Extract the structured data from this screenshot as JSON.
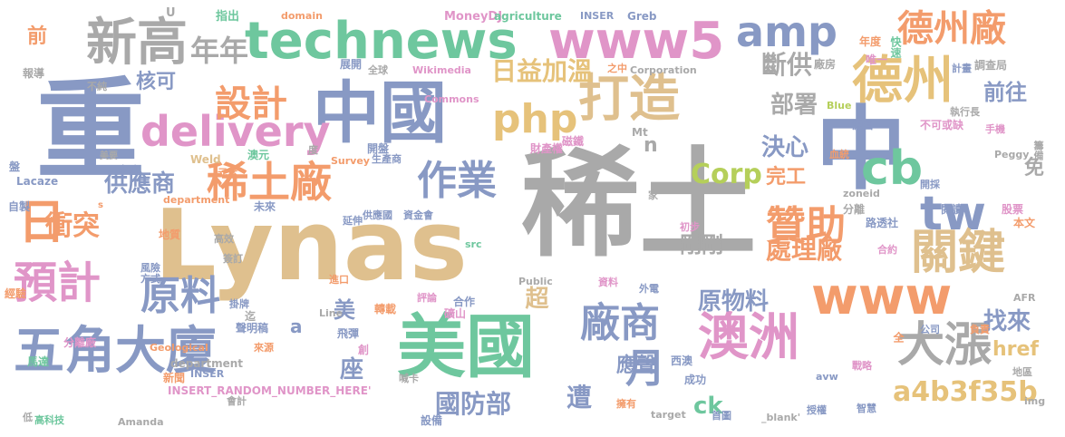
{
  "palette": {
    "grey": "#a9a9a9",
    "tan": "#dfc08e",
    "blue": "#8899c4",
    "green": "#6ec79e",
    "orange": "#f39c6c",
    "pink": "#e095c8",
    "olive": "#b5cf5a",
    "sand": "#e6c27a",
    "lightgrey": "#c2c2c2"
  },
  "words": [
    {
      "text": "稀土",
      "color": "grey"
    },
    {
      "text": "Lynas",
      "color": "tan"
    },
    {
      "text": "中國",
      "color": "blue"
    },
    {
      "text": "重",
      "color": "blue"
    },
    {
      "text": "美國",
      "color": "green"
    },
    {
      "text": "中",
      "color": "blue"
    },
    {
      "text": "technews",
      "color": "green"
    },
    {
      "text": "www5",
      "color": "pink"
    },
    {
      "text": "新高",
      "color": "grey"
    },
    {
      "text": "打造",
      "color": "tan"
    },
    {
      "text": "德州",
      "color": "sand"
    },
    {
      "text": "德州廠",
      "color": "orange"
    },
    {
      "text": "五角大廈",
      "color": "blue"
    },
    {
      "text": "澳洲",
      "color": "pink"
    },
    {
      "text": "稀土廠",
      "color": "orange"
    },
    {
      "text": "delivery",
      "color": "pink"
    },
    {
      "text": "php",
      "color": "sand"
    },
    {
      "text": "amp",
      "color": "blue"
    },
    {
      "text": "cb",
      "color": "green"
    },
    {
      "text": "tw",
      "color": "blue"
    },
    {
      "text": "www",
      "color": "orange"
    },
    {
      "text": "關鍵",
      "color": "tan"
    },
    {
      "text": "大漲",
      "color": "grey"
    },
    {
      "text": "預計",
      "color": "pink"
    },
    {
      "text": "日",
      "color": "orange"
    },
    {
      "text": "原料",
      "color": "blue"
    },
    {
      "text": "贊助",
      "color": "orange"
    },
    {
      "text": "設計",
      "color": "orange"
    },
    {
      "text": "作業",
      "color": "blue"
    },
    {
      "text": "廠商",
      "color": "blue"
    },
    {
      "text": "月",
      "color": "blue"
    },
    {
      "text": "年年",
      "color": "grey"
    },
    {
      "text": "日益加溫",
      "color": "sand"
    },
    {
      "text": "a4b3f35b",
      "color": "sand"
    },
    {
      "text": "衝突",
      "color": "orange"
    },
    {
      "text": "供應商",
      "color": "blue"
    },
    {
      "text": "Corp",
      "color": "olive"
    },
    {
      "text": "決心",
      "color": "blue"
    },
    {
      "text": "處理廠",
      "color": "orange"
    },
    {
      "text": "原物料",
      "color": "blue"
    },
    {
      "text": "國防部",
      "color": "blue"
    },
    {
      "text": "找來",
      "color": "blue"
    },
    {
      "text": "前往",
      "color": "blue"
    },
    {
      "text": "部署",
      "color": "grey"
    },
    {
      "text": "斷供",
      "color": "grey"
    },
    {
      "text": "核可",
      "color": "blue"
    },
    {
      "text": "前",
      "color": "orange"
    },
    {
      "text": "完工",
      "color": "orange"
    },
    {
      "text": "剛剛",
      "color": "grey"
    },
    {
      "text": "應聲",
      "color": "blue"
    },
    {
      "text": "遭",
      "color": "blue"
    },
    {
      "text": "ck",
      "color": "green"
    },
    {
      "text": "href",
      "color": "sand"
    },
    {
      "text": "美",
      "color": "blue"
    },
    {
      "text": "座",
      "color": "blue"
    },
    {
      "text": "超",
      "color": "tan"
    },
    {
      "text": "免",
      "color": "grey"
    },
    {
      "text": "n",
      "color": "grey"
    },
    {
      "text": "a",
      "color": "blue"
    },
    {
      "text": "指出",
      "color": "green"
    },
    {
      "text": "domain",
      "color": "orange"
    },
    {
      "text": "MoneyDJ",
      "color": "pink"
    },
    {
      "text": "agriculture",
      "color": "green"
    },
    {
      "text": "INSER",
      "color": "blue"
    },
    {
      "text": "Greb",
      "color": "blue"
    },
    {
      "text": "U",
      "color": "grey"
    },
    {
      "text": "年度",
      "color": "orange"
    },
    {
      "text": "唯一",
      "color": "pink"
    },
    {
      "text": "快速",
      "color": "green"
    },
    {
      "text": "廠房",
      "color": "grey"
    },
    {
      "text": "調查局",
      "color": "grey"
    },
    {
      "text": "報導",
      "color": "grey"
    },
    {
      "text": "展開",
      "color": "blue"
    },
    {
      "text": "全球",
      "color": "grey"
    },
    {
      "text": "Wikimedia",
      "color": "pink"
    },
    {
      "text": "之中",
      "color": "orange"
    },
    {
      "text": "Corporation",
      "color": "grey"
    },
    {
      "text": "計畫",
      "color": "blue"
    },
    {
      "text": "不純",
      "color": "grey"
    },
    {
      "text": "Commons",
      "color": "pink"
    },
    {
      "text": "Blue",
      "color": "olive"
    },
    {
      "text": "執行長",
      "color": "grey"
    },
    {
      "text": "Mt",
      "color": "grey"
    },
    {
      "text": "源自",
      "color": "blue"
    },
    {
      "text": "不可或缺",
      "color": "pink"
    },
    {
      "text": "手機",
      "color": "pink"
    },
    {
      "text": "盤",
      "color": "blue"
    },
    {
      "text": "美要",
      "color": "grey"
    },
    {
      "text": "金融",
      "color": "blue"
    },
    {
      "text": "澳元",
      "color": "green"
    },
    {
      "text": "度",
      "color": "grey"
    },
    {
      "text": "開盤",
      "color": "blue"
    },
    {
      "text": "財產權",
      "color": "pink"
    },
    {
      "text": "磁鐵",
      "color": "pink"
    },
    {
      "text": "血統",
      "color": "orange"
    },
    {
      "text": "Peggy",
      "color": "grey"
    },
    {
      "text": "籌備",
      "color": "grey"
    },
    {
      "text": "Weld",
      "color": "tan"
    },
    {
      "text": "元素",
      "color": "orange"
    },
    {
      "text": "Survey",
      "color": "orange"
    },
    {
      "text": "生產商",
      "color": "blue"
    },
    {
      "text": "Lacaze",
      "color": "blue"
    },
    {
      "text": "department",
      "color": "orange"
    },
    {
      "text": "家",
      "color": "grey"
    },
    {
      "text": "zoneid",
      "color": "grey"
    },
    {
      "text": "開採",
      "color": "blue"
    },
    {
      "text": "自製",
      "color": "blue"
    },
    {
      "text": "s",
      "color": "orange"
    },
    {
      "text": "未來",
      "color": "blue"
    },
    {
      "text": "延伸",
      "color": "blue"
    },
    {
      "text": "供應國",
      "color": "blue"
    },
    {
      "text": "資金會",
      "color": "blue"
    },
    {
      "text": "分離",
      "color": "grey"
    },
    {
      "text": "路透社",
      "color": "blue"
    },
    {
      "text": "閱讀",
      "color": "blue"
    },
    {
      "text": "股票",
      "color": "pink"
    },
    {
      "text": "本文",
      "color": "orange"
    },
    {
      "text": "地質",
      "color": "orange"
    },
    {
      "text": "高效",
      "color": "grey"
    },
    {
      "text": "src",
      "color": "green"
    },
    {
      "text": "初步",
      "color": "pink"
    },
    {
      "text": "合約",
      "color": "pink"
    },
    {
      "text": "簽訂",
      "color": "grey"
    },
    {
      "text": "風險",
      "color": "blue"
    },
    {
      "text": "方式",
      "color": "blue"
    },
    {
      "text": "進口",
      "color": "orange"
    },
    {
      "text": "Public",
      "color": "grey"
    },
    {
      "text": "資料",
      "color": "pink"
    },
    {
      "text": "外電",
      "color": "blue"
    },
    {
      "text": "AFR",
      "color": "grey"
    },
    {
      "text": "經驗",
      "color": "orange"
    },
    {
      "text": "掛牌",
      "color": "blue"
    },
    {
      "text": "轉載",
      "color": "orange"
    },
    {
      "text": "評論",
      "color": "pink"
    },
    {
      "text": "合作",
      "color": "blue"
    },
    {
      "text": "礦山",
      "color": "pink"
    },
    {
      "text": "迄",
      "color": "grey"
    },
    {
      "text": "聲明稿",
      "color": "blue"
    },
    {
      "text": "Line",
      "color": "grey"
    },
    {
      "text": "公司",
      "color": "blue"
    },
    {
      "text": "負責",
      "color": "orange"
    },
    {
      "text": "分離廠",
      "color": "pink"
    },
    {
      "text": "飛彈",
      "color": "blue"
    },
    {
      "text": "來源",
      "color": "orange"
    },
    {
      "text": "全",
      "color": "orange"
    },
    {
      "text": "Geological",
      "color": "orange"
    },
    {
      "text": "創",
      "color": "pink"
    },
    {
      "text": "西澳",
      "color": "blue"
    },
    {
      "text": "戰略",
      "color": "pink"
    },
    {
      "text": "地區",
      "color": "grey"
    },
    {
      "text": "馬達",
      "color": "green"
    },
    {
      "text": "department",
      "color": "grey"
    },
    {
      "text": "INSER",
      "color": "blue"
    },
    {
      "text": "新聞",
      "color": "orange"
    },
    {
      "text": "會計",
      "color": "grey"
    },
    {
      "text": "喊卡",
      "color": "grey"
    },
    {
      "text": "成功",
      "color": "blue"
    },
    {
      "text": "avw",
      "color": "blue"
    },
    {
      "text": "img",
      "color": "grey"
    },
    {
      "text": "INSERT_RANDOM_NUMBER_HERE'",
      "color": "pink"
    },
    {
      "text": "擁有",
      "color": "orange"
    },
    {
      "text": "target",
      "color": "grey"
    },
    {
      "text": "首圖",
      "color": "blue"
    },
    {
      "text": "_blank'",
      "color": "grey"
    },
    {
      "text": "授權",
      "color": "blue"
    },
    {
      "text": "智慧",
      "color": "blue"
    },
    {
      "text": "低",
      "color": "grey"
    },
    {
      "text": "高科技",
      "color": "green"
    },
    {
      "text": "Amanda",
      "color": "grey"
    },
    {
      "text": "設備",
      "color": "blue"
    }
  ]
}
